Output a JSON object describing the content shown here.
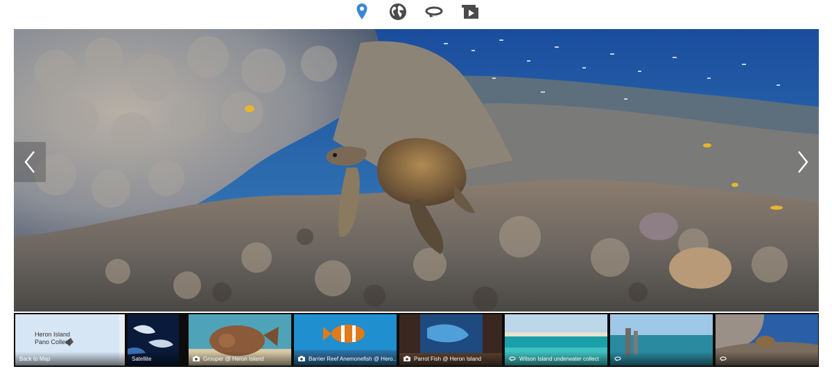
{
  "toolbar": {
    "items": [
      {
        "icon": "map-pin-icon",
        "color": "#3b86d8"
      },
      {
        "icon": "globe-icon",
        "color": "#4a4a4a"
      },
      {
        "icon": "rotate-360-icon",
        "color": "#4a4a4a"
      },
      {
        "icon": "slideshow-icon",
        "color": "#4a4a4a"
      }
    ]
  },
  "viewer": {
    "prev_icon": "chevron-left-icon",
    "next_icon": "chevron-right-icon"
  },
  "map_card": {
    "line1": "Heron Island",
    "line2": "Pano Collect"
  },
  "filmstrip": {
    "items": [
      {
        "label": "Back to Map",
        "icon": "none"
      },
      {
        "label": "Satellite",
        "icon": "none"
      },
      {
        "label": "Grouper @ Heron Island",
        "icon": "camera-icon"
      },
      {
        "label": "Barrier Reef Anemonefish @ Hero...",
        "icon": "camera-icon"
      },
      {
        "label": "Parrot Fish @ Heron Island",
        "icon": "camera-icon"
      },
      {
        "label": "Wilson Island underwater collect",
        "icon": "rotate-360-icon"
      },
      {
        "label": "",
        "icon": "rotate-360-icon"
      },
      {
        "label": "",
        "icon": "rotate-360-icon"
      }
    ]
  }
}
